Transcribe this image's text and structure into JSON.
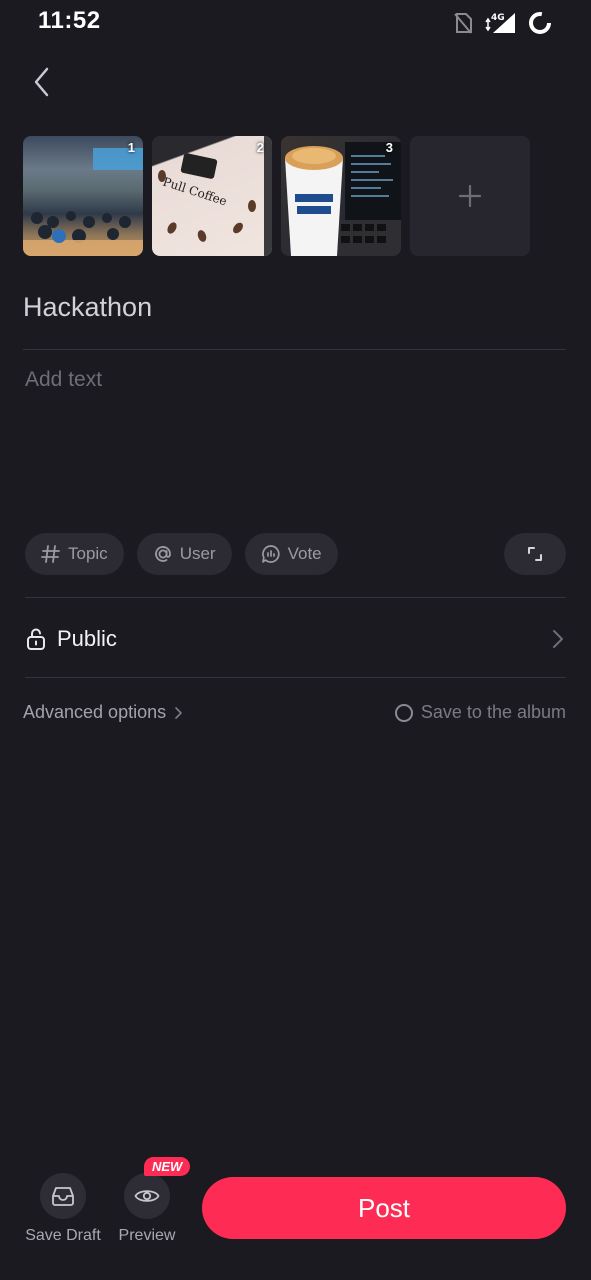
{
  "status_bar": {
    "time": "11:52",
    "network": "4G"
  },
  "thumbnails": [
    {
      "index": "1",
      "alt": "hackathon venue photo"
    },
    {
      "index": "2",
      "alt": "Pull Coffee machine photo"
    },
    {
      "index": "3",
      "alt": "coffee cup and laptop photo"
    }
  ],
  "post": {
    "title": "Hackathon",
    "body_placeholder": "Add text"
  },
  "chips": {
    "topic": "Topic",
    "user": "User",
    "vote": "Vote"
  },
  "privacy": {
    "label": "Public"
  },
  "advanced_label": "Advanced options",
  "save_album_label": "Save to the album",
  "bottom": {
    "save_draft": "Save Draft",
    "preview": "Preview",
    "new_badge": "NEW",
    "post": "Post"
  },
  "colors": {
    "accent": "#fe2c55",
    "background": "#1b1a21",
    "chip": "#2c2b33"
  }
}
